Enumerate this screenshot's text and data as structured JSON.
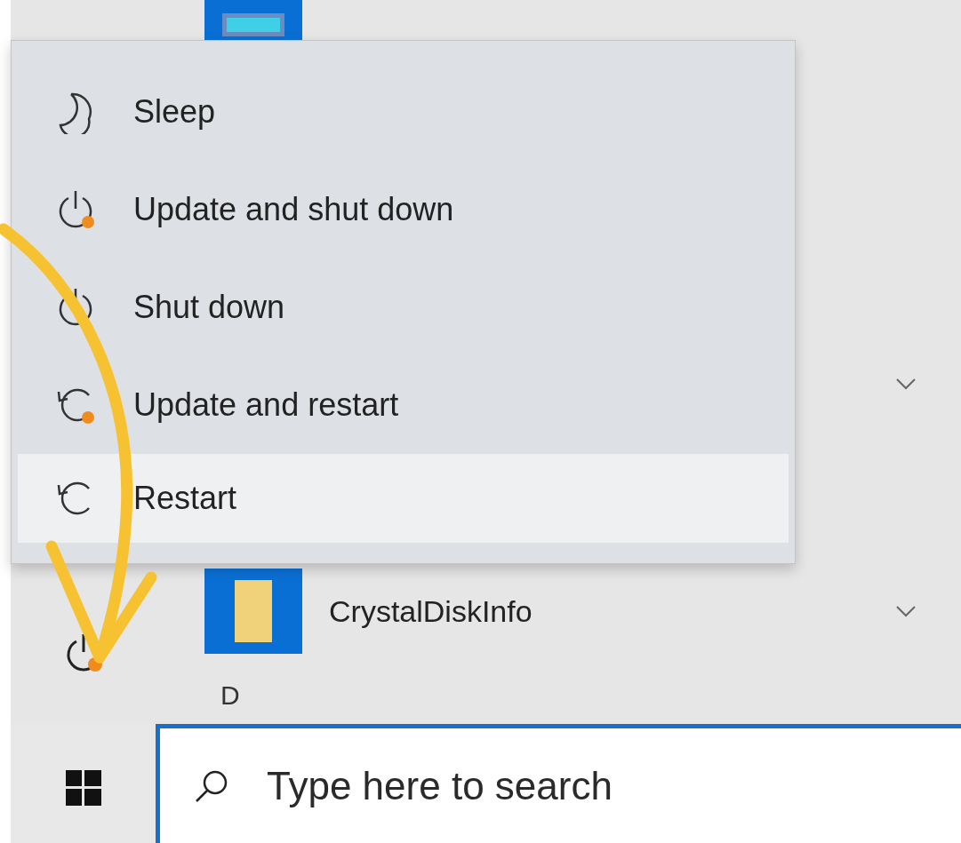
{
  "app_list": {
    "rows": [
      {
        "kind": "tile"
      },
      {
        "kind": "hidden",
        "expandable": true
      },
      {
        "kind": "folder",
        "name": "CrystalDiskInfo",
        "expandable": true
      }
    ],
    "section_letter": "D"
  },
  "rail": {
    "power_update_pending": true
  },
  "power_menu": {
    "items": [
      {
        "kind": "sleep",
        "label": "Sleep",
        "selected": false
      },
      {
        "kind": "update-shutdown",
        "label": "Update and shut down",
        "selected": false
      },
      {
        "kind": "shutdown",
        "label": "Shut down",
        "selected": false
      },
      {
        "kind": "update-restart",
        "label": "Update and restart",
        "selected": false
      },
      {
        "kind": "restart",
        "label": "Restart",
        "selected": true
      }
    ]
  },
  "taskbar": {
    "search": {
      "placeholder": "Type here to search"
    }
  }
}
